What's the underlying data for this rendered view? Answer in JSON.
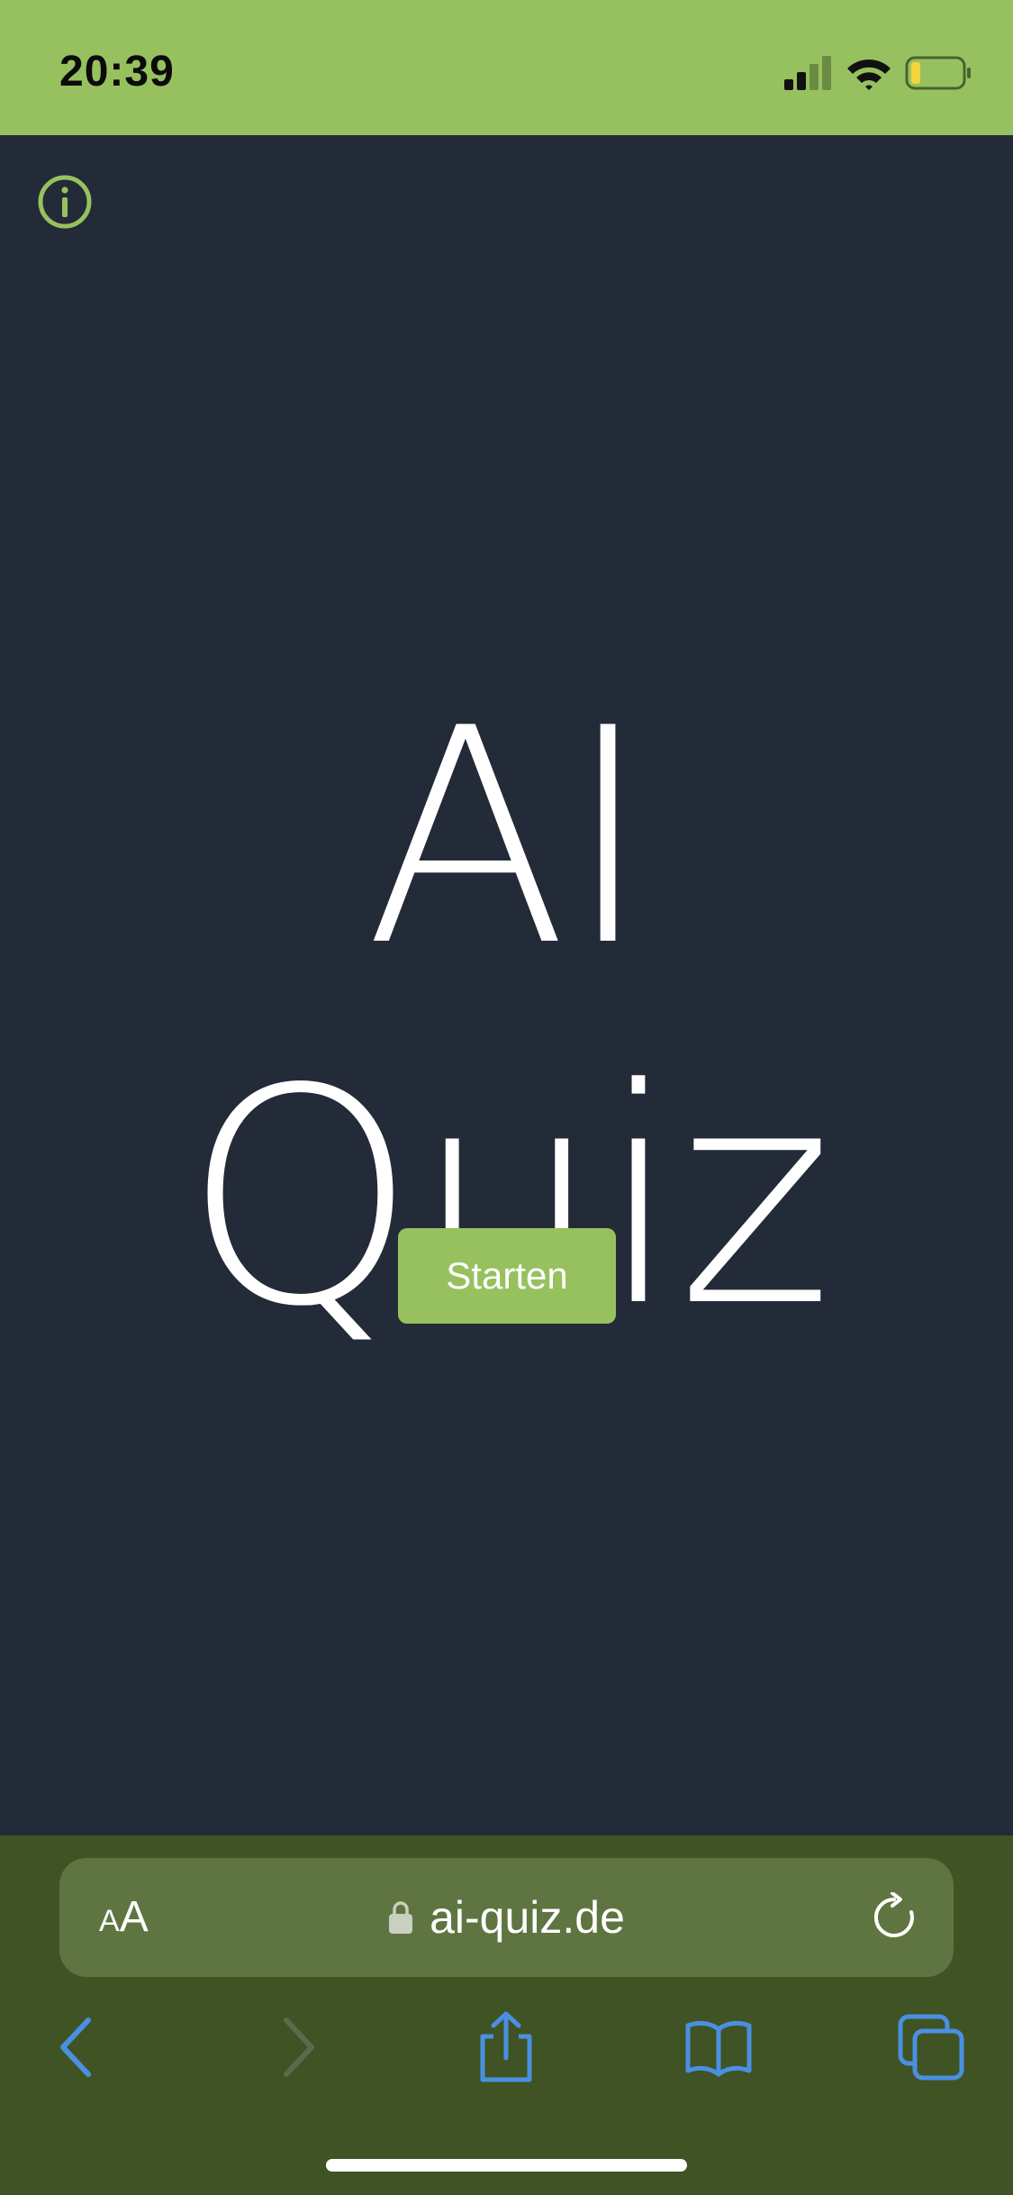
{
  "status_bar": {
    "time": "20:39",
    "icons": [
      "cellular-signal-icon",
      "wifi-icon",
      "battery-icon"
    ],
    "battery_level": 0.15
  },
  "header": {
    "info_icon": "info-icon"
  },
  "main": {
    "title": "AI Quiz",
    "start_label": "Starten"
  },
  "browser": {
    "text_size_label_small": "A",
    "text_size_label_large": "A",
    "url": "ai-quiz.de",
    "icons": [
      "lock-icon",
      "reload-icon",
      "back-icon",
      "forward-icon",
      "share-icon",
      "bookmarks-icon",
      "tabs-icon"
    ]
  },
  "colors": {
    "accent": "#97c15f",
    "background": "#232a38",
    "browser_chrome": "#405324",
    "url_bar": "#5f7541",
    "toolbar_icon": "#4a90e2"
  }
}
